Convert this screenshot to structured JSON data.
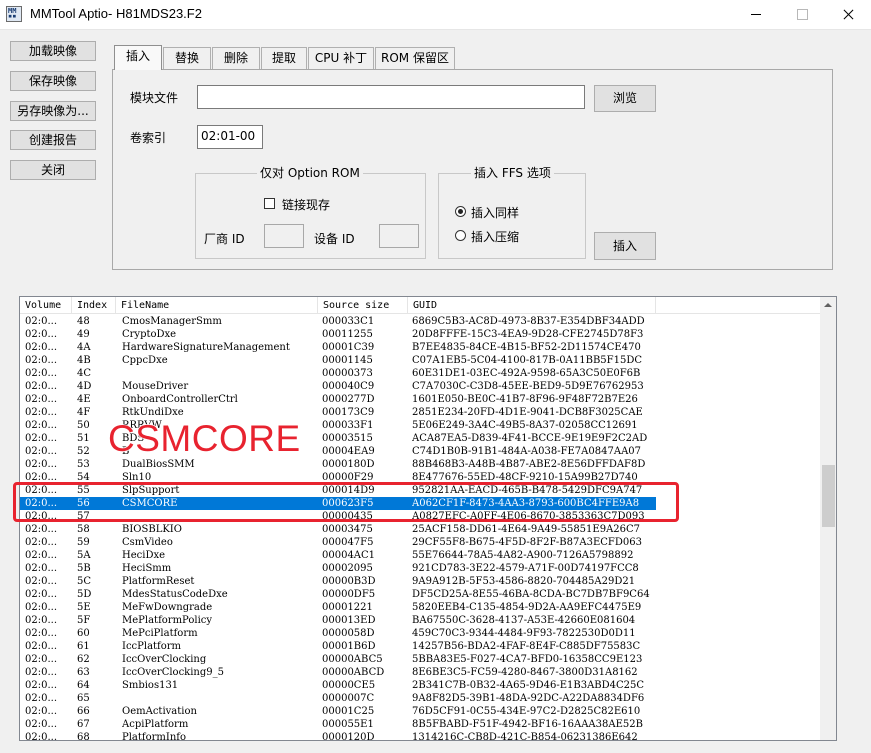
{
  "window": {
    "title": "MMTool Aptio- H81MDS23.F2",
    "icon_name": "mmtool-app-icon"
  },
  "left_buttons": {
    "load_image": "加载映像",
    "save_image": "保存映像",
    "save_image_as": "另存映像为...",
    "create_report": "创建报告",
    "close": "关闭"
  },
  "tabs": [
    {
      "label": "插入"
    },
    {
      "label": "替换"
    },
    {
      "label": "删除"
    },
    {
      "label": "提取"
    },
    {
      "label": "CPU 补丁"
    },
    {
      "label": "ROM 保留区"
    }
  ],
  "insert_panel": {
    "module_file_label": "模块文件",
    "module_file_value": "",
    "browse_button": "浏览",
    "volume_index_label": "卷索引",
    "volume_index_value": "02:01-00",
    "option_rom_group": "仅对 Option ROM",
    "link_existing_label": "链接现存",
    "vendor_id_label": "厂商 ID",
    "device_id_label": "设备 ID",
    "ffs_group": "插入 FFS 选项",
    "insert_as_is": "插入同样",
    "insert_compressed": "插入压缩",
    "insert_button": "插入"
  },
  "list": {
    "columns": [
      "Volume",
      "Index",
      "FileName",
      "Source size",
      "GUID"
    ],
    "rows": [
      {
        "vol": "02:0...",
        "idx": "48",
        "name": "CmosManagerSmm",
        "size": "000033C1",
        "guid": "6869C5B3-AC8D-4973-8B37-E354DBF34ADD"
      },
      {
        "vol": "02:0...",
        "idx": "49",
        "name": "CryptoDxe",
        "size": "00011255",
        "guid": "20D8FFFE-15C3-4EA9-9D28-CFE2745D78F3"
      },
      {
        "vol": "02:0...",
        "idx": "4A",
        "name": "HardwareSignatureManagement",
        "size": "00001C39",
        "guid": "B7EE4835-84CE-4B15-BF52-2D11574CE470"
      },
      {
        "vol": "02:0...",
        "idx": "4B",
        "name": "CppcDxe",
        "size": "00001145",
        "guid": "C07A1EB5-5C04-4100-817B-0A11BB5F15DC"
      },
      {
        "vol": "02:0...",
        "idx": "4C",
        "name": "",
        "size": "00000373",
        "guid": "60E31DE1-03EC-492A-9598-65A3C50E0F6B"
      },
      {
        "vol": "02:0...",
        "idx": "4D",
        "name": "MouseDriver",
        "size": "000040C9",
        "guid": "C7A7030C-C3D8-45EE-BED9-5D9E76762953"
      },
      {
        "vol": "02:0...",
        "idx": "4E",
        "name": "OnboardControllerCtrl",
        "size": "0000277D",
        "guid": "1601E050-BE0C-41B7-8F96-9F48F72B7E26"
      },
      {
        "vol": "02:0...",
        "idx": "4F",
        "name": "RtkUndiDxe",
        "size": "000173C9",
        "guid": "2851E234-20FD-4D1E-9041-DCB8F3025CAE"
      },
      {
        "vol": "02:0...",
        "idx": "50",
        "name": "RRRVW",
        "size": "000033F1",
        "guid": "5E06E249-3A4C-49B5-8A37-02058CC12691"
      },
      {
        "vol": "02:0...",
        "idx": "51",
        "name": "BDS",
        "size": "00003515",
        "guid": "ACA87EA5-D839-4F41-BCCE-9E19E9F2C2AD"
      },
      {
        "vol": "02:0...",
        "idx": "52",
        "name": "B",
        "size": "00004EA9",
        "guid": "C74D1B0B-91B1-484A-A038-FE7A0847AA07"
      },
      {
        "vol": "02:0...",
        "idx": "53",
        "name": "DualBiosSMM",
        "size": "0000180D",
        "guid": "88B468B3-A48B-4B87-ABE2-8E56DFFDAF8D"
      },
      {
        "vol": "02:0...",
        "idx": "54",
        "name": "Sln10",
        "size": "00000F29",
        "guid": "8E477676-55ED-48CF-9210-15A99B27D740"
      },
      {
        "vol": "02:0...",
        "idx": "55",
        "name": "SlpSupport",
        "size": "000014D9",
        "guid": "952821AA-EACD-465B-B478-5429DFC9A747"
      },
      {
        "vol": "02:0...",
        "idx": "56",
        "name": "CSMCORE",
        "size": "000623F5",
        "guid": "A062CF1F-8473-4AA3-8793-600BC4FFE9A8"
      },
      {
        "vol": "02:0...",
        "idx": "57",
        "name": "",
        "size": "00000435",
        "guid": "A0827EFC-A0FF-4E06-8670-3853363C7D093"
      },
      {
        "vol": "02:0...",
        "idx": "58",
        "name": "BIOSBLKIO",
        "size": "00003475",
        "guid": "25ACF158-DD61-4E64-9A49-55851E9A26C7"
      },
      {
        "vol": "02:0...",
        "idx": "59",
        "name": "CsmVideo",
        "size": "000047F5",
        "guid": "29CF55F8-B675-4F5D-8F2F-B87A3ECFD063"
      },
      {
        "vol": "02:0...",
        "idx": "5A",
        "name": "HeciDxe",
        "size": "00004AC1",
        "guid": "55E76644-78A5-4A82-A900-7126A5798892"
      },
      {
        "vol": "02:0...",
        "idx": "5B",
        "name": "HeciSmm",
        "size": "00002095",
        "guid": "921CD783-3E22-4579-A71F-00D74197FCC8"
      },
      {
        "vol": "02:0...",
        "idx": "5C",
        "name": "PlatformReset",
        "size": "00000B3D",
        "guid": "9A9A912B-5F53-4586-8820-704485A29D21"
      },
      {
        "vol": "02:0...",
        "idx": "5D",
        "name": "MdesStatusCodeDxe",
        "size": "00000DF5",
        "guid": "DF5CD25A-8E55-46BA-8CDA-BC7DB7BF9C64"
      },
      {
        "vol": "02:0...",
        "idx": "5E",
        "name": "MeFwDowngrade",
        "size": "00001221",
        "guid": "5820EEB4-C135-4854-9D2A-AA9EFC4475E9"
      },
      {
        "vol": "02:0...",
        "idx": "5F",
        "name": "MePlatformPolicy",
        "size": "000013ED",
        "guid": "BA67550C-3628-4137-A53E-42660E081604"
      },
      {
        "vol": "02:0...",
        "idx": "60",
        "name": "MePciPlatform",
        "size": "0000058D",
        "guid": "459C70C3-9344-4484-9F93-7822530D0D11"
      },
      {
        "vol": "02:0...",
        "idx": "61",
        "name": "IccPlatform",
        "size": "00001B6D",
        "guid": "14257B56-BDA2-4FAF-8E4F-C885DF75583C"
      },
      {
        "vol": "02:0...",
        "idx": "62",
        "name": "IccOverClocking",
        "size": "00000ABC5",
        "guid": "5BBA83E5-F027-4CA7-BFD0-16358CC9E123"
      },
      {
        "vol": "02:0...",
        "idx": "63",
        "name": "IccOverClocking9_5",
        "size": "00000ABCD",
        "guid": "8E6BE3C5-FC59-4280-8467-3800D31A8162"
      },
      {
        "vol": "02:0...",
        "idx": "64",
        "name": "Smbios131",
        "size": "00000CE5",
        "guid": "2B341C7B-0B32-4A65-9D46-E1B3ABD4C25C"
      },
      {
        "vol": "02:0...",
        "idx": "65",
        "name": "",
        "size": "0000007C",
        "guid": "9A8F82D5-39B1-48DA-92DC-A22DA8834DF6"
      },
      {
        "vol": "02:0...",
        "idx": "66",
        "name": "OemActivation",
        "size": "00001C25",
        "guid": "76D5CF91-0C55-434E-97C2-D2825C82E610"
      },
      {
        "vol": "02:0...",
        "idx": "67",
        "name": "AcpiPlatform",
        "size": "000055E1",
        "guid": "8B5FBABD-F51F-4942-BF16-16AAA38AE52B"
      },
      {
        "vol": "02:0...",
        "idx": "68",
        "name": "PlatformInfo",
        "size": "0000120D",
        "guid": "1314216C-CB8D-421C-B854-06231386E642"
      }
    ],
    "selected_index": "56"
  },
  "annotation": {
    "text": "CSMCORE",
    "color": "#e8232f"
  },
  "colors": {
    "selection": "#0078d7",
    "annotation_red": "#e8232f"
  }
}
